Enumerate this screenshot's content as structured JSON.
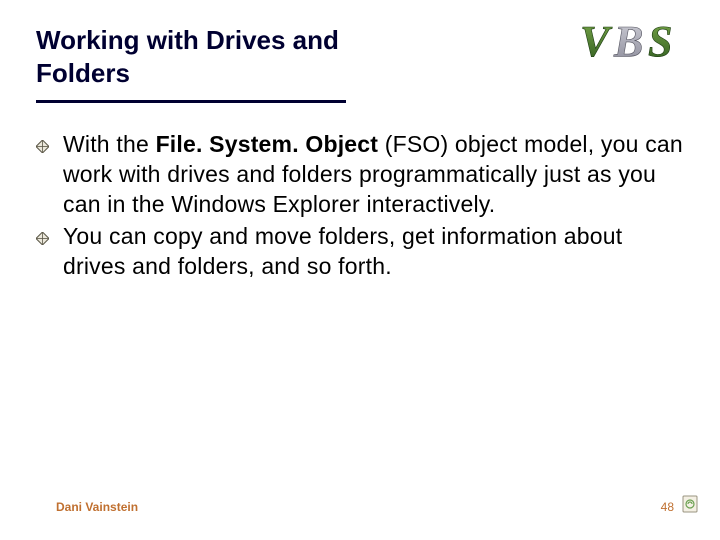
{
  "header": {
    "title": "Working with Drives and Folders",
    "logo_text": "VBS"
  },
  "bullets": [
    {
      "prefix": "With the ",
      "bold": "File. System. Object",
      "suffix": " (FSO) object model, you can work with drives and folders programmatically just as you can in the Windows Explorer interactively."
    },
    {
      "prefix": "",
      "bold": "",
      "suffix": "You can copy and move folders, get information about drives and folders, and so forth."
    }
  ],
  "footer": {
    "author": "Dani Vainstein",
    "page": "48"
  }
}
